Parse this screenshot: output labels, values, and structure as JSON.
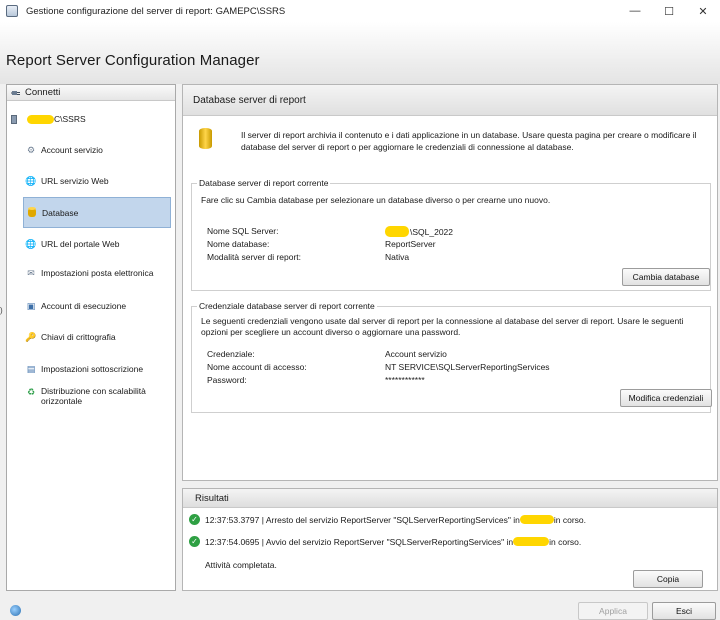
{
  "window": {
    "title": "Gestione configurazione del server di report: GAMEPC\\SSRS",
    "minimize_glyph": "—",
    "maximize_glyph": "☐",
    "close_glyph": "✕"
  },
  "header": {
    "title": "Report Server Configuration Manager"
  },
  "sidebar": {
    "connect_label": "Connetti",
    "server_suffix": "C\\SSRS",
    "items": [
      {
        "label": "Account servizio",
        "icon": "service-account-icon",
        "glyph": "⚙"
      },
      {
        "label": "URL servizio Web",
        "icon": "web-service-url-icon",
        "glyph": "🌐"
      },
      {
        "label": "Database",
        "icon": "database-icon",
        "glyph": ""
      },
      {
        "label": "URL del portale Web",
        "icon": "web-portal-url-icon",
        "glyph": "🌐"
      },
      {
        "label": "Impostazioni posta elettronica",
        "icon": "email-settings-icon",
        "glyph": "✉"
      },
      {
        "label": "Account di esecuzione",
        "icon": "execution-account-icon",
        "glyph": "▣"
      },
      {
        "label": "Chiavi di crittografia",
        "icon": "encryption-key-icon",
        "glyph": "🔑"
      },
      {
        "label": "Impostazioni sottoscrizione",
        "icon": "subscription-settings-icon",
        "glyph": "▤"
      },
      {
        "label": "Distribuzione con scalabilità orizzontale",
        "icon": "scale-out-icon",
        "glyph": "♻"
      }
    ],
    "active_index": 2
  },
  "content": {
    "title": "Database server di report",
    "intro": "Il server di report archivia il contenuto e i dati applicazione in un database. Usare questa pagina per creare o modificare il database del server di report o per aggiornare le credenziali di connessione al database.",
    "current_db": {
      "group_title": "Database server di report corrente",
      "description": "Fare clic su Cambia database per selezionare un database diverso o per crearne uno nuovo.",
      "sql_server_label": "Nome SQL Server:",
      "sql_server_value": "\\SQL_2022",
      "db_name_label": "Nome database:",
      "db_name_value": "ReportServer",
      "mode_label": "Modalità server di report:",
      "mode_value": "Nativa",
      "change_button": "Cambia database"
    },
    "credentials": {
      "group_title": "Credenziale database server di report corrente",
      "description": "Le seguenti credenziali vengono usate dal server di report per la connessione al database del server di report. Usare le seguenti opzioni per scegliere un account diverso o aggiornare una password.",
      "credential_label": "Credenziale:",
      "credential_value": "Account servizio",
      "login_label": "Nome account di accesso:",
      "login_value": "NT SERVICE\\SQLServerReportingServices",
      "password_label": "Password:",
      "password_value": "************",
      "modify_button": "Modifica credenziali"
    }
  },
  "results": {
    "title": "Risultati",
    "rows": [
      {
        "prefix": "12:37:53.3797 | Arresto del servizio ReportServer \"SQLServerReportingServices\" in",
        "suffix": " in corso."
      },
      {
        "prefix": "12:37:54.0695 | Avvio del servizio ReportServer \"SQLServerReportingServices\" in",
        "suffix": " in corso."
      }
    ],
    "done": "Attività completata.",
    "copy_button": "Copia"
  },
  "footer": {
    "apply_button": "Applica",
    "exit_button": "Esci"
  },
  "colors": {
    "highlight": "#ffd600",
    "selection": "#c2d6ec",
    "success": "#2ea043"
  }
}
